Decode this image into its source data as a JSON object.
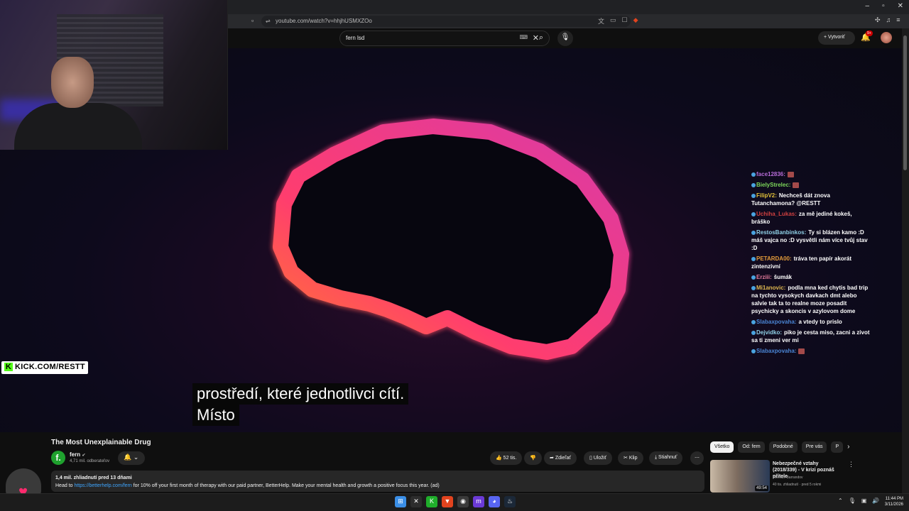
{
  "browser": {
    "window_controls": [
      "–",
      "▫",
      "✕"
    ],
    "url": "youtube.com/watch?v=hhjhUSMXZOo",
    "address_icons": [
      "translate-icon",
      "screenshot-icon",
      "bookmark-icon"
    ],
    "bookmark_glyph": "▫"
  },
  "youtube": {
    "search_value": "fern lsd",
    "create_label": "Vytvoriť",
    "notif_count": "9+"
  },
  "stream_overlay": {
    "kick_label": "KICK.COM/RESTT",
    "kick_k": "K",
    "subtitle_line1": "prostředí, které jednotlivci cítí.",
    "subtitle_line2": "Místo"
  },
  "chat": [
    {
      "user": "face12836:",
      "text": "",
      "user_color": "#b56bd6",
      "emote": true
    },
    {
      "user": "BielyStrelec:",
      "text": "",
      "user_color": "#7cd65a",
      "emote": true
    },
    {
      "user": "FilipV2:",
      "text": "Nechceš dát znova Tutanchamona? @RESTT",
      "user_color": "#e3c23a",
      "emote": false
    },
    {
      "user": "Uchiha_Lukas:",
      "text": "za mě jediné kokeš, bráško",
      "user_color": "#d04040",
      "emote": false
    },
    {
      "user": "RestosBanbinkos:",
      "text": "Ty si blázen kamo :D máš vajca no :D vysvětli nám více tvůj stav :D",
      "user_color": "#8fd0e6",
      "emote": false
    },
    {
      "user": "PETARDA00:",
      "text": "tráva ten papír akorát zintenzivní",
      "user_color": "#e39b3a",
      "emote": false
    },
    {
      "user": "Erziii:",
      "text": "šumák",
      "user_color": "#e37a9b",
      "emote": false
    },
    {
      "user": "Mi1anovic:",
      "text": "podla mna ked chytis bad trip na tychto vysokych davkach dmt alebo salvie tak ta to realne moze posadit psychicky a skoncis v azylovom dome",
      "user_color": "#e0b850",
      "emote": false
    },
    {
      "user": "Slabaxpovaha:",
      "text": "a vtedy to prislo",
      "user_color": "#4a86d6",
      "emote": false
    },
    {
      "user": "Dejvidko:",
      "text": "piko je cesta miso, zacni a zivot sa ti zmeni ver mi",
      "user_color": "#8fd0e6",
      "emote": false
    },
    {
      "user": "Slabaxpovaha:",
      "text": "",
      "user_color": "#4a86d6",
      "emote": true
    }
  ],
  "video": {
    "title": "The Most Unexplainable Drug",
    "channel_initial": "f.",
    "channel": "fern",
    "verified": "✔",
    "subscribers": "4,71 mil. odberateľov",
    "likes": "52 tis.",
    "share_label": "Zdieľať",
    "save_label": "Uložiť",
    "clip_label": "Klip",
    "download_label": "Stiahnuť",
    "views_date": "1,4 mil. zhliadnutí  pred 13 dňami",
    "desc_prefix": "Head to ",
    "desc_link": "https://betterhelp.com/fern",
    "desc_suffix": " for 10% off your first month of therapy with our paid partner, BetterHelp. Make your mental health and growth a positive focus this year. (ad)"
  },
  "sidebar": {
    "chips": [
      "Všetko",
      "Od: fern",
      "Podobné",
      "Pre vás",
      "P"
    ],
    "recommended": {
      "title": "Nebezpečné vztahy (2018/339) - V krizi poznáš přítele",
      "channel": "Televize Barrandov",
      "meta": "40 tis. zhliadnutí · pred 5 rokmi",
      "duration": "49:54"
    }
  },
  "taskbar": {
    "time": "11:44 PM",
    "date": "3/11/2026",
    "apps": [
      {
        "name": "windows-icon",
        "glyph": "⊞",
        "color": "#3a8ee6"
      },
      {
        "name": "xbox-icon",
        "glyph": "✕",
        "color": "#2d2d2d"
      },
      {
        "name": "kick-app-icon",
        "glyph": "K",
        "color": "#1fae2b"
      },
      {
        "name": "brave-icon",
        "glyph": "▼",
        "color": "#e2431e"
      },
      {
        "name": "obs-icon",
        "glyph": "◉",
        "color": "#3a3a3a"
      },
      {
        "name": "app-icon",
        "glyph": "m",
        "color": "#6b3ad6"
      },
      {
        "name": "discord-icon",
        "glyph": "◕",
        "color": "#5865f2"
      },
      {
        "name": "steam-icon",
        "glyph": "♨",
        "color": "#1b2838"
      }
    ]
  }
}
